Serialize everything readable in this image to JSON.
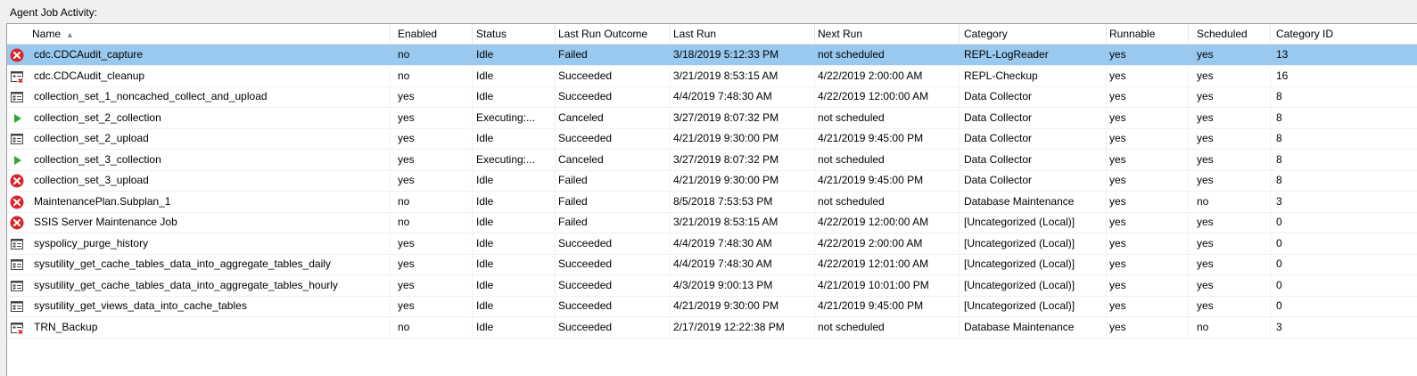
{
  "panel": {
    "title": "Agent Job Activity:"
  },
  "columns": [
    {
      "key": "name",
      "label": "Name"
    },
    {
      "key": "enabled",
      "label": "Enabled"
    },
    {
      "key": "status",
      "label": "Status"
    },
    {
      "key": "outcome",
      "label": "Last Run Outcome"
    },
    {
      "key": "lastrun",
      "label": "Last Run"
    },
    {
      "key": "nextrun",
      "label": "Next Run"
    },
    {
      "key": "category",
      "label": "Category"
    },
    {
      "key": "runnable",
      "label": "Runnable"
    },
    {
      "key": "scheduled",
      "label": "Scheduled"
    },
    {
      "key": "catid",
      "label": "Category ID"
    }
  ],
  "sort": {
    "column": "Name",
    "direction": "ascending"
  },
  "selected_row": 0,
  "colors": {
    "selection": "#99c9ef",
    "failed": "#d9262c",
    "running": "#2fa82f"
  },
  "rows": [
    {
      "icon": "failed-icon",
      "name": "cdc.CDCAudit_capture",
      "enabled": "no",
      "status": "Idle",
      "outcome": "Failed",
      "lastrun": "3/18/2019 5:12:33 PM",
      "nextrun": "not scheduled",
      "category": "REPL-LogReader",
      "runnable": "yes",
      "scheduled": "yes",
      "catid": "13"
    },
    {
      "icon": "job-disabled-icon",
      "name": "cdc.CDCAudit_cleanup",
      "enabled": "no",
      "status": "Idle",
      "outcome": "Succeeded",
      "lastrun": "3/21/2019 8:53:15 AM",
      "nextrun": "4/22/2019 2:00:00 AM",
      "category": "REPL-Checkup",
      "runnable": "yes",
      "scheduled": "yes",
      "catid": "16"
    },
    {
      "icon": "job-icon",
      "name": "collection_set_1_noncached_collect_and_upload",
      "enabled": "yes",
      "status": "Idle",
      "outcome": "Succeeded",
      "lastrun": "4/4/2019 7:48:30 AM",
      "nextrun": "4/22/2019 12:00:00 AM",
      "category": "Data Collector",
      "runnable": "yes",
      "scheduled": "yes",
      "catid": "8"
    },
    {
      "icon": "running-icon",
      "name": "collection_set_2_collection",
      "enabled": "yes",
      "status": "Executing:...",
      "outcome": "Canceled",
      "lastrun": "3/27/2019 8:07:32 PM",
      "nextrun": "not scheduled",
      "category": "Data Collector",
      "runnable": "yes",
      "scheduled": "yes",
      "catid": "8"
    },
    {
      "icon": "job-icon",
      "name": "collection_set_2_upload",
      "enabled": "yes",
      "status": "Idle",
      "outcome": "Succeeded",
      "lastrun": "4/21/2019 9:30:00 PM",
      "nextrun": "4/21/2019 9:45:00 PM",
      "category": "Data Collector",
      "runnable": "yes",
      "scheduled": "yes",
      "catid": "8"
    },
    {
      "icon": "running-icon",
      "name": "collection_set_3_collection",
      "enabled": "yes",
      "status": "Executing:...",
      "outcome": "Canceled",
      "lastrun": "3/27/2019 8:07:32 PM",
      "nextrun": "not scheduled",
      "category": "Data Collector",
      "runnable": "yes",
      "scheduled": "yes",
      "catid": "8"
    },
    {
      "icon": "failed-icon",
      "name": "collection_set_3_upload",
      "enabled": "yes",
      "status": "Idle",
      "outcome": "Failed",
      "lastrun": "4/21/2019 9:30:00 PM",
      "nextrun": "4/21/2019 9:45:00 PM",
      "category": "Data Collector",
      "runnable": "yes",
      "scheduled": "yes",
      "catid": "8"
    },
    {
      "icon": "failed-icon",
      "name": "MaintenancePlan.Subplan_1",
      "enabled": "no",
      "status": "Idle",
      "outcome": "Failed",
      "lastrun": "8/5/2018 7:53:53 PM",
      "nextrun": "not scheduled",
      "category": "Database Maintenance",
      "runnable": "yes",
      "scheduled": "no",
      "catid": "3"
    },
    {
      "icon": "failed-icon",
      "name": "SSIS Server Maintenance Job",
      "enabled": "no",
      "status": "Idle",
      "outcome": "Failed",
      "lastrun": "3/21/2019 8:53:15 AM",
      "nextrun": "4/22/2019 12:00:00 AM",
      "category": "[Uncategorized (Local)]",
      "runnable": "yes",
      "scheduled": "yes",
      "catid": "0"
    },
    {
      "icon": "job-icon",
      "name": "syspolicy_purge_history",
      "enabled": "yes",
      "status": "Idle",
      "outcome": "Succeeded",
      "lastrun": "4/4/2019 7:48:30 AM",
      "nextrun": "4/22/2019 2:00:00 AM",
      "category": "[Uncategorized (Local)]",
      "runnable": "yes",
      "scheduled": "yes",
      "catid": "0"
    },
    {
      "icon": "job-icon",
      "name": "sysutility_get_cache_tables_data_into_aggregate_tables_daily",
      "enabled": "yes",
      "status": "Idle",
      "outcome": "Succeeded",
      "lastrun": "4/4/2019 7:48:30 AM",
      "nextrun": "4/22/2019 12:01:00 AM",
      "category": "[Uncategorized (Local)]",
      "runnable": "yes",
      "scheduled": "yes",
      "catid": "0"
    },
    {
      "icon": "job-icon",
      "name": "sysutility_get_cache_tables_data_into_aggregate_tables_hourly",
      "enabled": "yes",
      "status": "Idle",
      "outcome": "Succeeded",
      "lastrun": "4/3/2019 9:00:13 PM",
      "nextrun": "4/21/2019 10:01:00 PM",
      "category": "[Uncategorized (Local)]",
      "runnable": "yes",
      "scheduled": "yes",
      "catid": "0"
    },
    {
      "icon": "job-icon",
      "name": "sysutility_get_views_data_into_cache_tables",
      "enabled": "yes",
      "status": "Idle",
      "outcome": "Succeeded",
      "lastrun": "4/21/2019 9:30:00 PM",
      "nextrun": "4/21/2019 9:45:00 PM",
      "category": "[Uncategorized (Local)]",
      "runnable": "yes",
      "scheduled": "yes",
      "catid": "0"
    },
    {
      "icon": "job-disabled-icon",
      "name": "TRN_Backup",
      "enabled": "no",
      "status": "Idle",
      "outcome": "Succeeded",
      "lastrun": "2/17/2019 12:22:38 PM",
      "nextrun": "not scheduled",
      "category": "Database Maintenance",
      "runnable": "yes",
      "scheduled": "no",
      "catid": "3"
    }
  ]
}
